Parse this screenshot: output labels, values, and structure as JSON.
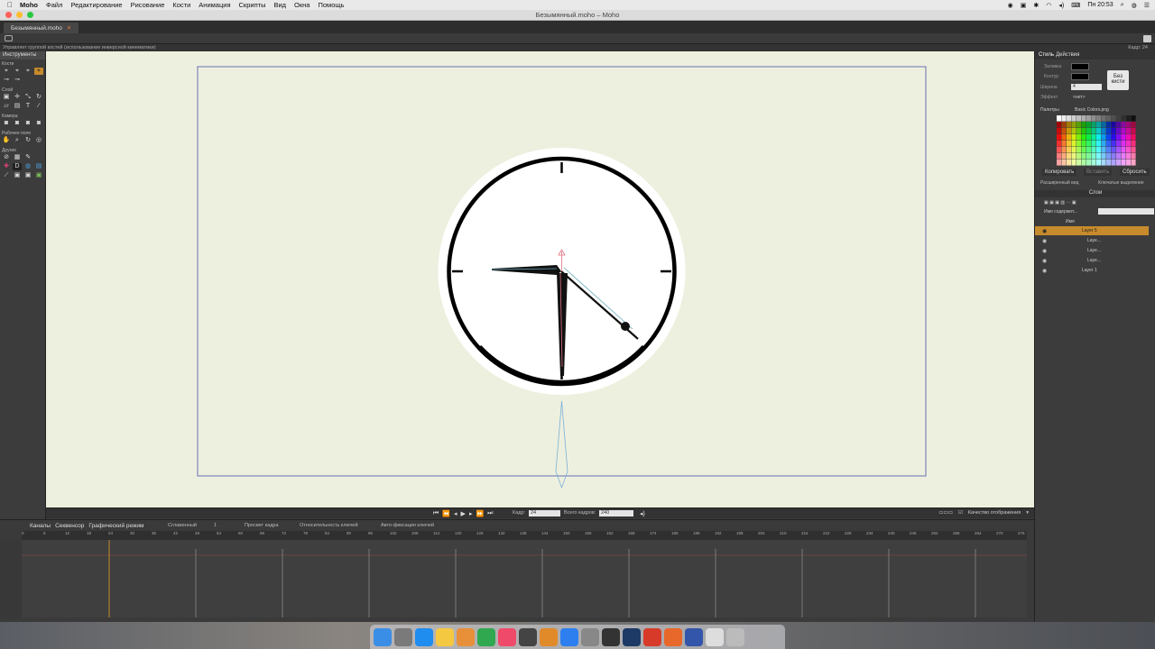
{
  "menubar": {
    "app_name": "Moho",
    "items": [
      "Файл",
      "Редактирование",
      "Рисование",
      "Кости",
      "Анимация",
      "Скрипты",
      "Вид",
      "Окна",
      "Помощь"
    ],
    "clock": "Пн 20:53"
  },
  "window": {
    "title": "Безымянный.moho – Moho",
    "doc_tab": "Безымянный.moho",
    "doc_tab_close": "✕"
  },
  "status": {
    "hint": "Управляет группой костей (использование инверсной кинематики)",
    "frame_label": "Кадр: 24"
  },
  "tools": {
    "header": "Инструменты",
    "sections": [
      "Кости",
      "Слой",
      "Камера",
      "Рабочее поле",
      "Другие"
    ]
  },
  "playback": {
    "frame_label": "Кадр:",
    "frame_value": "24",
    "total_label": "Всего кадров:",
    "total_value": "240",
    "quality": "Качество отображения"
  },
  "timeline": {
    "tabs": [
      "Каналы",
      "Секвенсор",
      "Графический режим"
    ],
    "smooth": "Сглаженный",
    "interp": "1",
    "onion": "Просвет кадра",
    "relative": "Относительность ключей",
    "autofix": "Авто-фиксация ключей",
    "ruler": [
      "0",
      "6",
      "12",
      "18",
      "24",
      "30",
      "36",
      "42",
      "48",
      "54",
      "60",
      "66",
      "72",
      "78",
      "84",
      "90",
      "96",
      "102",
      "108",
      "114",
      "120",
      "126",
      "132",
      "138",
      "144",
      "150",
      "156",
      "162",
      "168",
      "174",
      "180",
      "186",
      "192",
      "198",
      "204",
      "210",
      "216",
      "222",
      "228",
      "234",
      "240",
      "246",
      "252",
      "258",
      "264",
      "270",
      "276"
    ]
  },
  "style_panel": {
    "tabs": [
      "Стиль",
      "Действия"
    ],
    "fill_label": "Заливка",
    "stroke_label": "Контур",
    "width_label": "Ширина",
    "width_value": "4",
    "effect_label": "Эффект",
    "effect_value": "<нет>",
    "no_brush": "Без кисти",
    "palettes_label": "Палитры",
    "palette_name": "Basic Colors.png",
    "copy_btn": "Копировать",
    "paste_btn": "Вставить",
    "reset_btn": "Сбросить",
    "extended_view": "Расширенный вид",
    "select_fill": "Ключатые выделение"
  },
  "layers_panel": {
    "title": "Слои",
    "search_placeholder": "Имя содержит...",
    "col_name": "Имя",
    "layers": [
      {
        "name": "Layer 5",
        "selected": true
      },
      {
        "name": "Laye...",
        "selected": false
      },
      {
        "name": "Laye...",
        "selected": false
      },
      {
        "name": "Laye...",
        "selected": false
      },
      {
        "name": "Layer 1",
        "selected": false
      }
    ]
  },
  "colors": {
    "accent": "#c78a2c",
    "canvas_bg": "#eef0df",
    "panel_bg": "#3c3c3c"
  },
  "dock_apps": [
    "finder-icon",
    "launchpad-icon",
    "safari-icon",
    "notes-icon",
    "photos-icon",
    "chrome-icon",
    "music-icon",
    "videos-icon",
    "books-icon",
    "appstore-icon",
    "settings-icon",
    "pro-icon",
    "photoshop-icon",
    "affinity-icon",
    "moho-icon",
    "vectorize-icon",
    "downloads-icon",
    "trash-icon"
  ]
}
